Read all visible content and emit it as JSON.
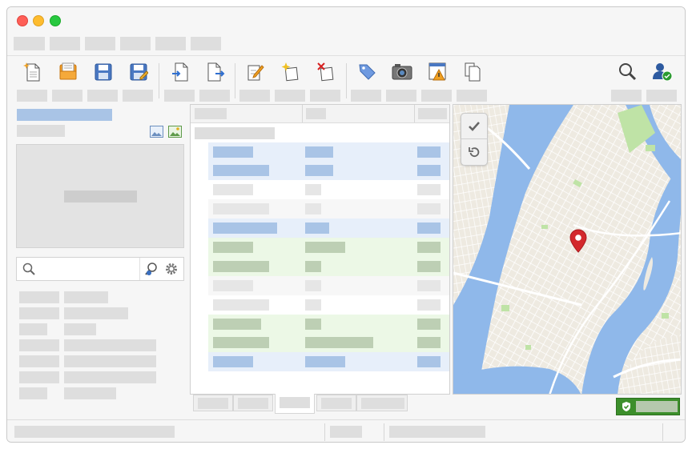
{
  "window": {
    "controls": [
      "close",
      "minimize",
      "zoom"
    ]
  },
  "toolbar": {
    "icons": [
      "new-document-icon",
      "open-icon",
      "save-icon",
      "save-as-icon",
      "import-icon",
      "export-icon",
      "edit-icon",
      "new-note-icon",
      "delete-icon",
      "tag-icon",
      "camera-icon",
      "warning-icon",
      "duplicate-icon",
      "search-icon",
      "user-verified-icon"
    ]
  },
  "sidebar": {
    "icons": [
      "image-icon",
      "landscape-icon",
      "search-icon",
      "user-search-icon",
      "gear-icon"
    ]
  },
  "map": {
    "controls": [
      "check-icon",
      "refresh-icon"
    ]
  },
  "status": {
    "security_icon": "shield-check-icon"
  },
  "colors": {
    "accent_blue": "#a9c4e6",
    "accent_green": "#3c8f2b",
    "pin_red": "#d3282c",
    "water": "#8fb8ea",
    "land": "#efebe2",
    "park": "#bfe3a6"
  }
}
